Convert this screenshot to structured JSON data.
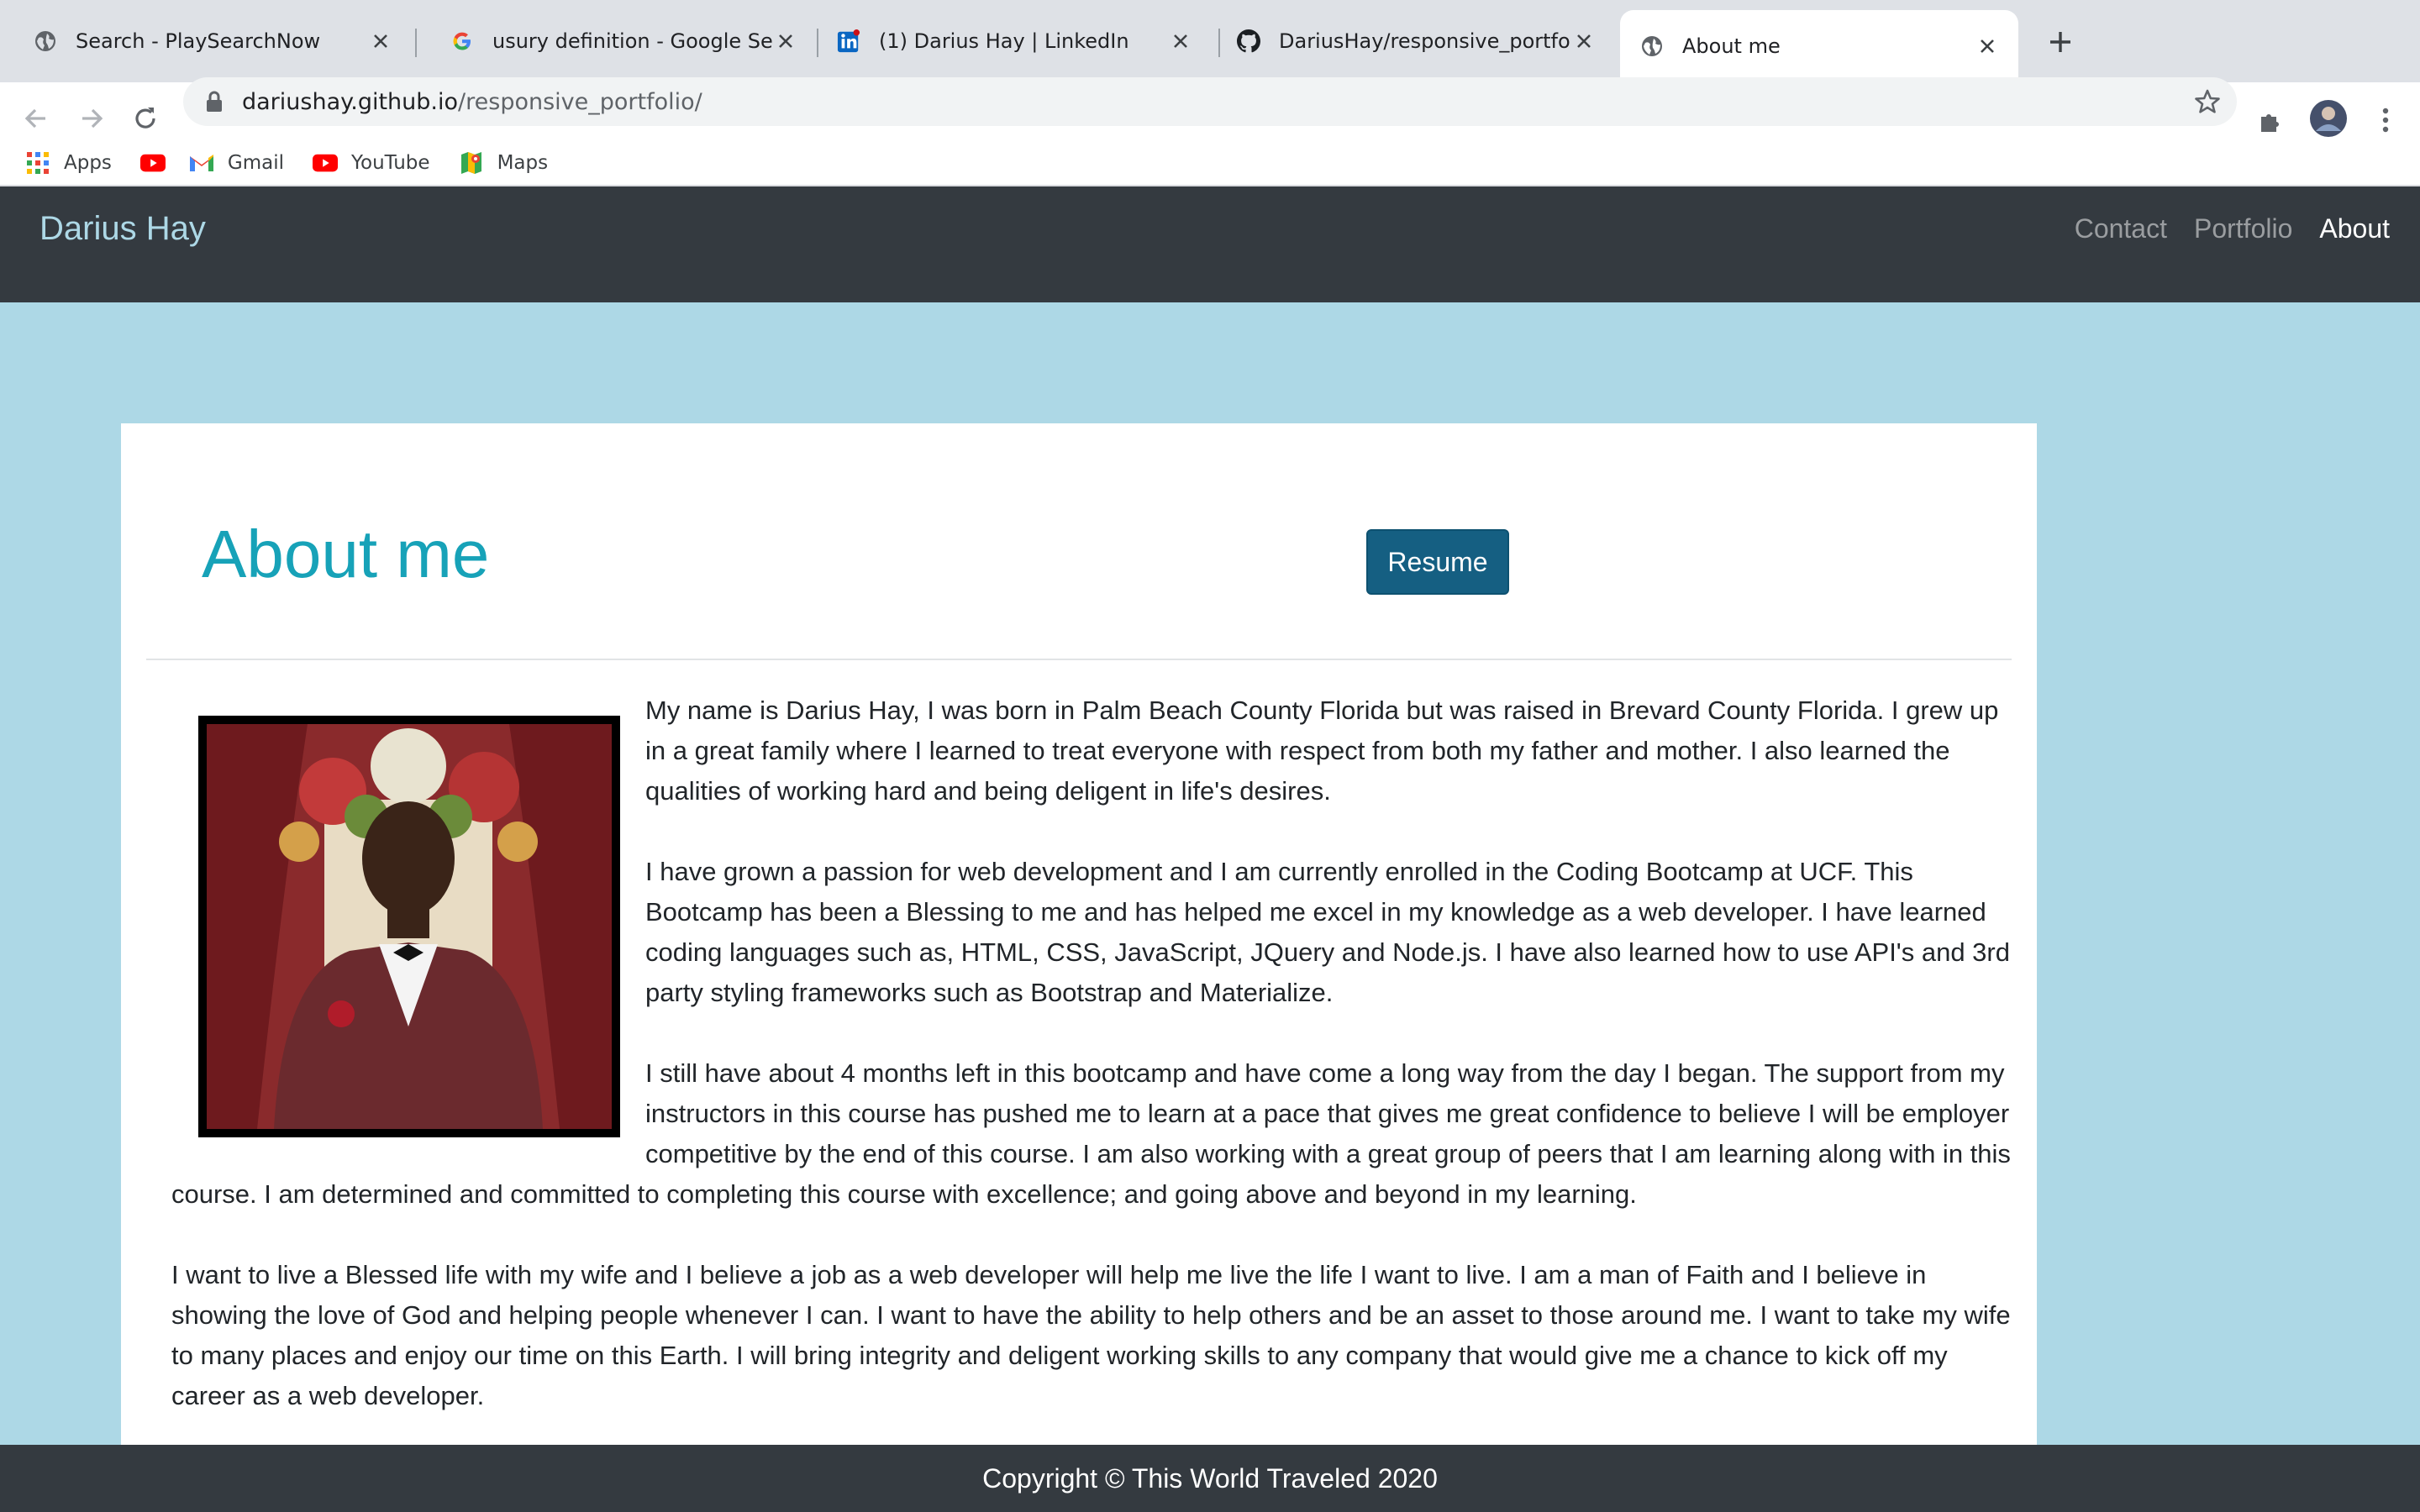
{
  "browser": {
    "tabs": [
      {
        "title": "Search - PlaySearchNow",
        "icon": "globe-icon"
      },
      {
        "title": "usury definition - Google Search",
        "icon": "google-icon"
      },
      {
        "title": "(1) Darius Hay | LinkedIn",
        "icon": "linkedin-icon"
      },
      {
        "title": "DariusHay/responsive_portfolio",
        "icon": "github-icon"
      },
      {
        "title": "About me",
        "icon": "globe-icon",
        "active": true
      }
    ],
    "url_domain": "dariushay.github.io",
    "url_path": "/responsive_portfolio/",
    "bookmarks": [
      {
        "label": "Apps",
        "icon": "apps-grid-icon"
      },
      {
        "label": "",
        "icon": "youtube-icon"
      },
      {
        "label": "Gmail",
        "icon": "gmail-icon"
      },
      {
        "label": "YouTube",
        "icon": "youtube-icon"
      },
      {
        "label": "Maps",
        "icon": "maps-icon"
      }
    ]
  },
  "site": {
    "brand": "Darius Hay",
    "nav": [
      "Contact",
      "Portfolio",
      "About"
    ],
    "active_nav": "About",
    "colors": {
      "nav_bg": "#343a40",
      "page_bg": "#add8e6",
      "title": "#17a2b8",
      "button": "#155f82"
    }
  },
  "about": {
    "title": "About me",
    "resume_label": "Resume",
    "paragraphs": [
      " My name is Darius Hay, I was born in Palm Beach County Florida but was raised in Brevard County Florida. I grew up in a great family where I learned to treat everyone with respect from both my father and mother. I also learned the qualities of working hard and being deligent in life's desires.",
      "I have grown a passion for web development and I am currently enrolled in the Coding Bootcamp at UCF. This Bootcamp has been a Blessing to me and has helped me excel in my knowledge as a web developer. I have learned coding languages such as, HTML, CSS, JavaScript, JQuery and Node.js. I have also learned how to use API's and 3rd party styling frameworks such as Bootstrap and Materialize.",
      "I still have about 4 months left in this bootcamp and have come a long way from the day I began. The support from my instructors in this course has pushed me to learn at a pace that gives me great confidence to believe I will be employer competitive by the end of this course. I am also working with a great group of peers that I am learning along with in this course. I am determined and committed to completing this course with excellence; and going above and beyond in my learning.",
      "I want to live a Blessed life with my wife and I believe a job as a web developer will help me live the life I want to live. I am a man of Faith and I believe in showing the love of God and helping people whenever I can. I want to have the ability to help others and be an asset to those around me. I want to take my wife to many places and enjoy our time on this Earth. I will bring integrity and deligent working skills to any company that would give me a chance to kick off my career as a web developer."
    ]
  },
  "footer": {
    "text": "Copyright © This World Traveled 2020"
  }
}
